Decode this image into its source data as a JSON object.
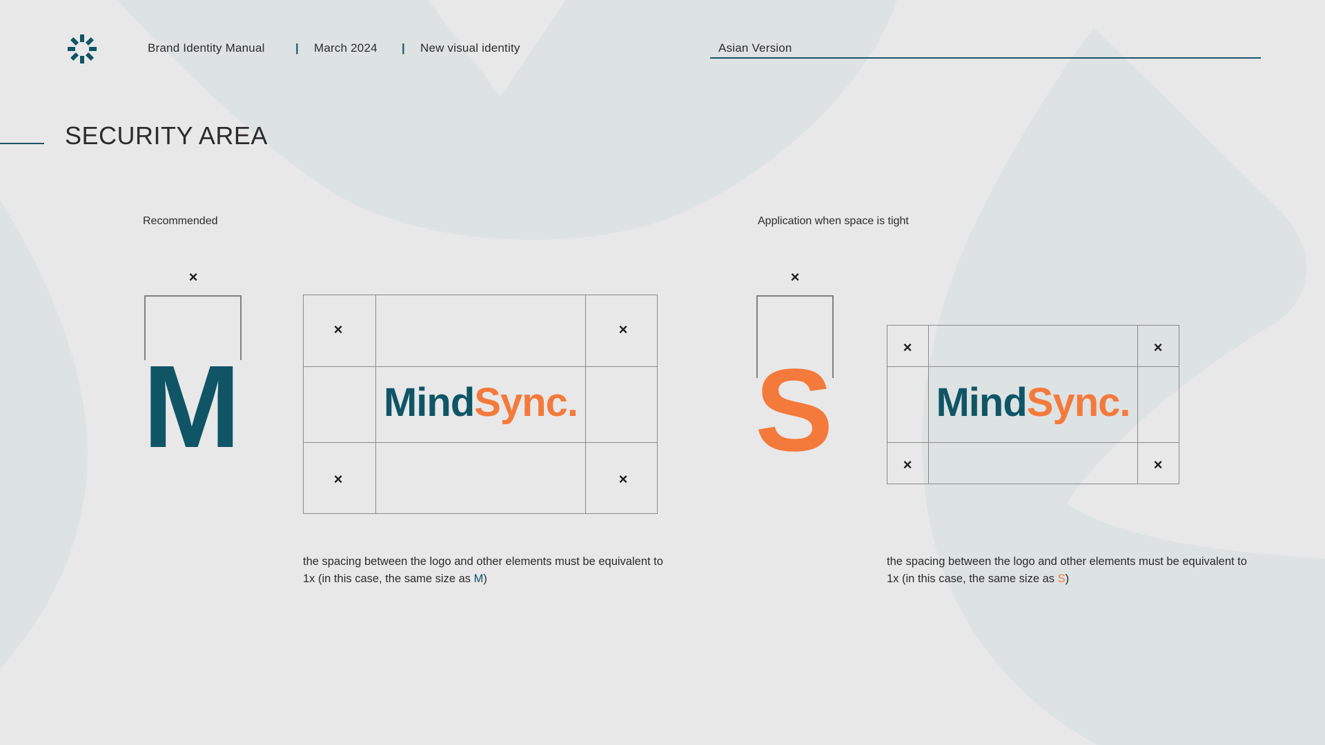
{
  "colors": {
    "primary": "#0f5566",
    "accent": "#f47a3c",
    "text": "#2b2b2b",
    "background": "#e8e8e8",
    "shape": "#dde2e3"
  },
  "header": {
    "logo_icon": "sunburst-logo-icon",
    "manual": "Brand Identity Manual",
    "separator": "|",
    "date": "March 2024",
    "subtitle": "New visual identity",
    "version": "Asian Version"
  },
  "page": {
    "title": "SECURITY AREA"
  },
  "recommended": {
    "label": "Recommended",
    "unit_letter": "M",
    "cross": "×",
    "wordmark_primary": "Mind",
    "wordmark_accent": "Sync.",
    "caption_text": "the spacing between the logo and other elements must be equivalent to 1x (in this case, the same size as ",
    "caption_open": "(",
    "caption_highlight": "M",
    "caption_close": ")"
  },
  "tight": {
    "label": "Application when space is tight",
    "unit_letter": "S",
    "cross": "×",
    "wordmark_primary": "Mind",
    "wordmark_accent": "Sync.",
    "caption_text": "the spacing between the logo and other elements must be equivalent to 1x (in this case, the same size as ",
    "caption_highlight": "S",
    "caption_close": ")"
  }
}
